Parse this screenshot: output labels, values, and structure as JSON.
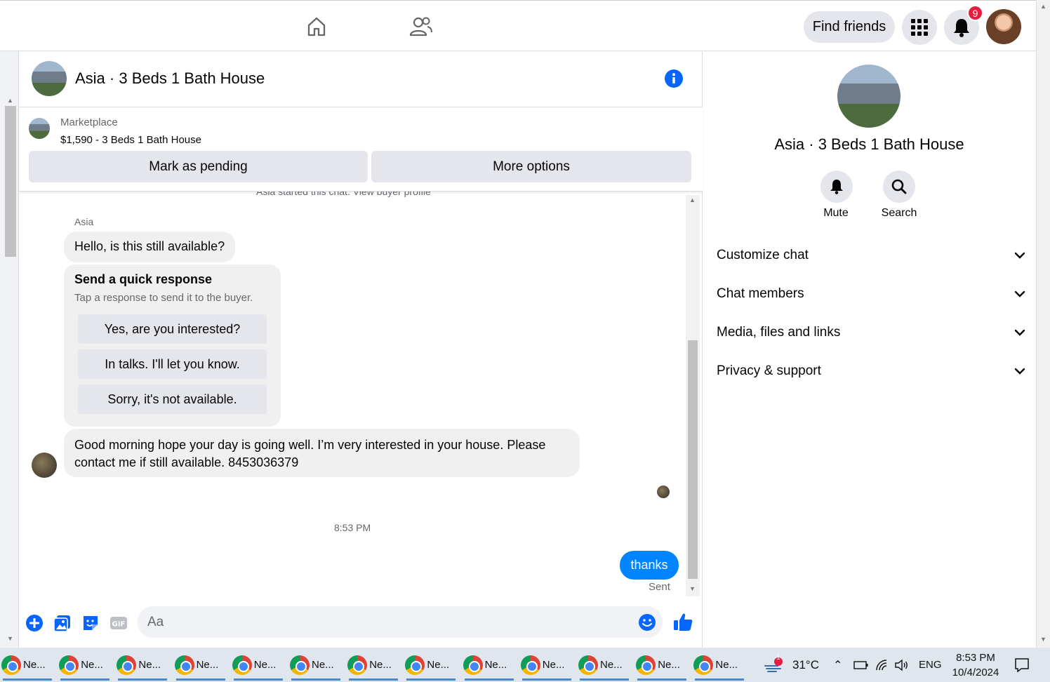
{
  "topbar": {
    "home_icon": "home-icon",
    "friends_icon": "friends-icon",
    "find_friends_label": "Find friends",
    "menu_icon": "grid-menu-icon",
    "notifications_icon": "bell-icon",
    "notifications_count": "9"
  },
  "chat": {
    "title": "Asia · 3 Beds 1 Bath House",
    "marketplace_label": "Marketplace",
    "listing": "$1,590 - 3 Beds 1 Bath House",
    "mark_pending_label": "Mark as pending",
    "more_options_label": "More options",
    "started_text": "Asia started this chat. View buyer profile",
    "sender_name": "Asia",
    "message_1": "Hello, is this still available?",
    "quick_response_title": "Send a quick response",
    "quick_response_sub": "Tap a response to send it to the buyer.",
    "quick_responses": [
      "Yes, are you interested?",
      "In talks. I'll let you know.",
      "Sorry, it's not available."
    ],
    "message_2": "Good morning hope your day is going well. I’m very interested in your house.  Please contact me if still available. 8453036379",
    "time": "8:53 PM",
    "outgoing": "thanks",
    "sent_label": "Sent",
    "composer_placeholder": "Aa"
  },
  "info_panel": {
    "title": "Asia · 3 Beds 1 Bath House",
    "mute_label": "Mute",
    "search_label": "Search",
    "sections": [
      "Customize chat",
      "Chat members",
      "Media, files and links",
      "Privacy & support"
    ]
  },
  "taskbar": {
    "item_label": "Ne...",
    "item_count": 13,
    "temperature": "31°C",
    "weather_badge": "1",
    "language": "ENG",
    "clock_time": "8:53 PM",
    "clock_date": "10/4/2024"
  },
  "colors": {
    "accent": "#0084ff",
    "badge": "#e41e3f",
    "button_grey": "#e4e6eb"
  }
}
